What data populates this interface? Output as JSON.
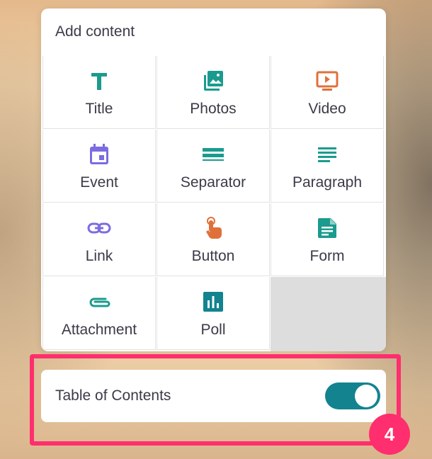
{
  "panel": {
    "title": "Add content"
  },
  "tiles": [
    {
      "label": "Title",
      "icon": "title-icon",
      "color": "#1a9b8e"
    },
    {
      "label": "Photos",
      "icon": "photos-icon",
      "color": "#1a9b8e"
    },
    {
      "label": "Video",
      "icon": "video-icon",
      "color": "#e0703a"
    },
    {
      "label": "Event",
      "icon": "event-icon",
      "color": "#7b6ce0"
    },
    {
      "label": "Separator",
      "icon": "separator-icon",
      "color": "#1a9b8e"
    },
    {
      "label": "Paragraph",
      "icon": "paragraph-icon",
      "color": "#1a9b8e"
    },
    {
      "label": "Link",
      "icon": "link-icon",
      "color": "#7b6ce0"
    },
    {
      "label": "Button",
      "icon": "pointer-hand-icon",
      "color": "#e0703a"
    },
    {
      "label": "Form",
      "icon": "form-document-icon",
      "color": "#1a9b8e"
    },
    {
      "label": "Attachment",
      "icon": "paperclip-icon",
      "color": "#1a9b8e"
    },
    {
      "label": "Poll",
      "icon": "poll-chart-icon",
      "color": "#12838f"
    }
  ],
  "toc": {
    "label": "Table of Contents",
    "enabled": true,
    "toggle_color": "#12838f"
  },
  "annotation": {
    "badge": "4",
    "color": "#ff2e6e"
  }
}
